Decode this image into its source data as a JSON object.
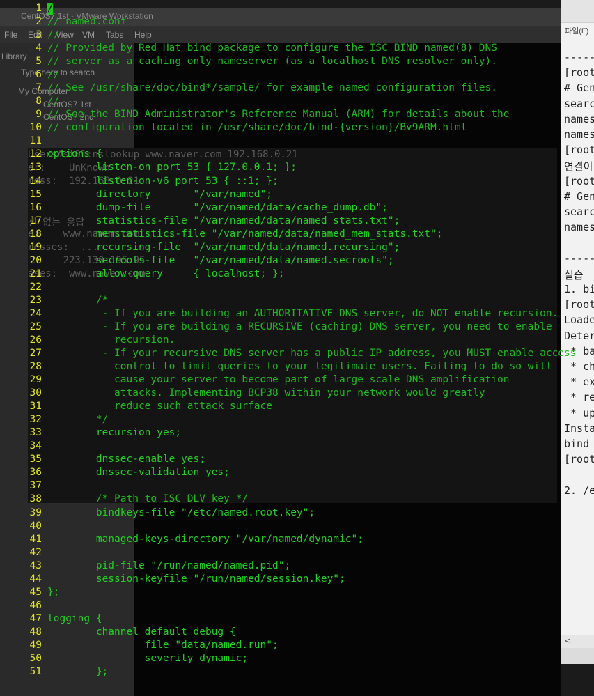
{
  "vmware": {
    "window_title": "CentOS7 1st - VMware Workstation",
    "menu": [
      "File",
      "Edit",
      "View",
      "VM",
      "Tabs",
      "Help"
    ],
    "library_label": "Library",
    "search_placeholder": "Type here to search",
    "tree": [
      "My Computer",
      "CentOS7 1st",
      "CentOS7 2nd"
    ]
  },
  "right_pane": {
    "file_menu": "파일(F)",
    "lines": [
      "-----",
      "[root",
      "# Gen",
      "searc",
      "names",
      "names",
      "[root",
      "연결이",
      "[root",
      "# Gen",
      "searc",
      "names",
      "",
      "-----",
      "실습",
      "1. bi",
      "[root",
      "Loade",
      "Deter",
      " * ba",
      " * ch",
      " * ex",
      " * re",
      " * up",
      "Insta",
      "bind",
      "[root",
      "",
      "2. /e"
    ],
    "scroll_left": "<"
  },
  "dim_cmd": {
    "lines": [
      "Users#st01:nslookup www.naver.com 192.168.0.21",
      "er:    UnKnown",
      "ress:  192.168.0.21",
      "",
      "신 없는 응답",
      "e:    www.naver.com",
      "resses:  ...",
      "      223.130.195.95",
      "ases:  www.naver.com"
    ]
  },
  "editor": {
    "cursor_char": "/",
    "lines": [
      {
        "n": "1",
        "t": "/",
        "c": true
      },
      {
        "n": "2",
        "t": "// named.conf",
        "c": true
      },
      {
        "n": "3",
        "t": "//",
        "c": true
      },
      {
        "n": "4",
        "t": "// Provided by Red Hat bind package to configure the ISC BIND named(8) DNS",
        "c": true
      },
      {
        "n": "5",
        "t": "// server as a caching only nameserver (as a localhost DNS resolver only).",
        "c": true
      },
      {
        "n": "6",
        "t": "//",
        "c": true
      },
      {
        "n": "7",
        "t": "// See /usr/share/doc/bind*/sample/ for example named configuration files.",
        "c": true
      },
      {
        "n": "8",
        "t": "//",
        "c": true
      },
      {
        "n": "9",
        "t": "// See the BIND Administrator's Reference Manual (ARM) for details about the",
        "c": true
      },
      {
        "n": "10",
        "t": "// configuration located in /usr/share/doc/bind-{version}/Bv9ARM.html",
        "c": true
      },
      {
        "n": "11",
        "t": "",
        "c": false
      },
      {
        "n": "12",
        "t": "options {",
        "c": false
      },
      {
        "n": "13",
        "t": "        listen-on port 53 { 127.0.0.1; };",
        "c": false
      },
      {
        "n": "14",
        "t": "        listen-on-v6 port 53 { ::1; };",
        "c": false
      },
      {
        "n": "15",
        "t": "        directory       \"/var/named\";",
        "c": false
      },
      {
        "n": "16",
        "t": "        dump-file       \"/var/named/data/cache_dump.db\";",
        "c": false
      },
      {
        "n": "17",
        "t": "        statistics-file \"/var/named/data/named_stats.txt\";",
        "c": false
      },
      {
        "n": "18",
        "t": "        memstatistics-file \"/var/named/data/named_mem_stats.txt\";",
        "c": false
      },
      {
        "n": "19",
        "t": "        recursing-file  \"/var/named/data/named.recursing\";",
        "c": false
      },
      {
        "n": "20",
        "t": "        secroots-file   \"/var/named/data/named.secroots\";",
        "c": false
      },
      {
        "n": "21",
        "t": "        allow-query     { localhost; };",
        "c": false
      },
      {
        "n": "22",
        "t": "",
        "c": false
      },
      {
        "n": "23",
        "t": "        /*",
        "c": true
      },
      {
        "n": "24",
        "t": "         - If you are building an AUTHORITATIVE DNS server, do NOT enable recursion.",
        "c": true
      },
      {
        "n": "25",
        "t": "         - If you are building a RECURSIVE (caching) DNS server, you need to enable",
        "c": true
      },
      {
        "n": "26",
        "t": "           recursion.",
        "c": true
      },
      {
        "n": "27",
        "t": "         - If your recursive DNS server has a public IP address, you MUST enable access",
        "c": true
      },
      {
        "n": "28",
        "t": "           control to limit queries to your legitimate users. Failing to do so will",
        "c": true
      },
      {
        "n": "29",
        "t": "           cause your server to become part of large scale DNS amplification",
        "c": true
      },
      {
        "n": "30",
        "t": "           attacks. Implementing BCP38 within your network would greatly",
        "c": true
      },
      {
        "n": "31",
        "t": "           reduce such attack surface",
        "c": true
      },
      {
        "n": "32",
        "t": "        */",
        "c": true
      },
      {
        "n": "33",
        "t": "        recursion yes;",
        "c": false
      },
      {
        "n": "34",
        "t": "",
        "c": false
      },
      {
        "n": "35",
        "t": "        dnssec-enable yes;",
        "c": false
      },
      {
        "n": "36",
        "t": "        dnssec-validation yes;",
        "c": false
      },
      {
        "n": "37",
        "t": "",
        "c": false
      },
      {
        "n": "38",
        "t": "        /* Path to ISC DLV key */",
        "c": true
      },
      {
        "n": "39",
        "t": "        bindkeys-file \"/etc/named.root.key\";",
        "c": false
      },
      {
        "n": "40",
        "t": "",
        "c": false
      },
      {
        "n": "41",
        "t": "        managed-keys-directory \"/var/named/dynamic\";",
        "c": false
      },
      {
        "n": "42",
        "t": "",
        "c": false
      },
      {
        "n": "43",
        "t": "        pid-file \"/run/named/named.pid\";",
        "c": false
      },
      {
        "n": "44",
        "t": "        session-keyfile \"/run/named/session.key\";",
        "c": false
      },
      {
        "n": "45",
        "t": "};",
        "c": false
      },
      {
        "n": "46",
        "t": "",
        "c": false
      },
      {
        "n": "47",
        "t": "logging {",
        "c": false
      },
      {
        "n": "48",
        "t": "        channel default_debug {",
        "c": false
      },
      {
        "n": "49",
        "t": "                file \"data/named.run\";",
        "c": false
      },
      {
        "n": "50",
        "t": "                severity dynamic;",
        "c": false
      },
      {
        "n": "51",
        "t": "        };",
        "c": false
      }
    ],
    "colors": {
      "line_number": "#e7e721",
      "code": "#22d022",
      "cursor": "#1ec81e"
    }
  }
}
